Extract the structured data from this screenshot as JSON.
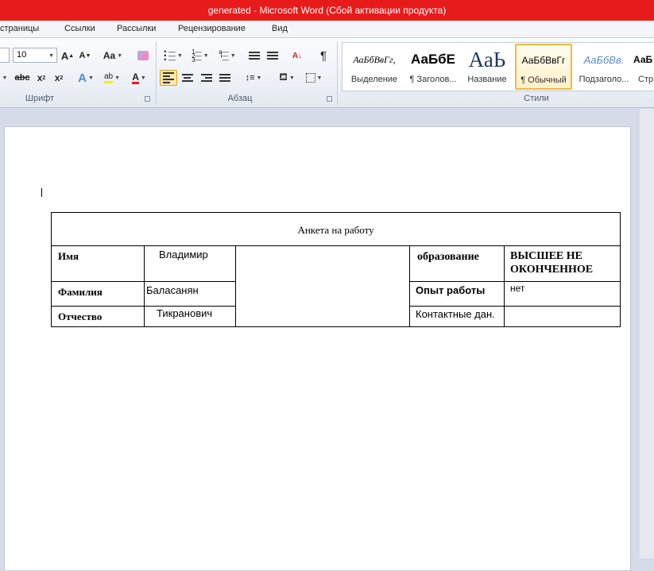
{
  "window": {
    "title_doc": "generated",
    "title_app": "Microsoft Word (Сбой активации продукта)"
  },
  "tabs": [
    "страницы",
    "Ссылки",
    "Рассылки",
    "Рецензирование",
    "Вид"
  ],
  "ribbon": {
    "font_size": "10",
    "groups": {
      "font": "Шрифт",
      "paragraph": "Абзац",
      "styles": "Стили"
    },
    "font_buttons": {
      "grow": "A",
      "shrink": "A",
      "case": "Aa",
      "strike": "abc",
      "sub": "x",
      "sup": "x",
      "effects": "A",
      "highlight": "ab",
      "color": "A"
    },
    "pilcrow": "¶",
    "styles": [
      {
        "sample": "АаБбВвГг,",
        "name": "Выделение"
      },
      {
        "sample": "АаБбЕ",
        "name": "¶ Заголов..."
      },
      {
        "sample": "АаЬ",
        "name": "Название"
      },
      {
        "sample": "АаБбВвГг",
        "name": "¶ Обычный"
      },
      {
        "sample": "АаБбВв.",
        "name": "Подзаголо..."
      },
      {
        "sample": "АаБ",
        "name": "Стр"
      }
    ]
  },
  "document": {
    "table": {
      "title": "Анкета на работу",
      "rows": [
        {
          "label": "Имя",
          "value": "Владимир",
          "label2": "образование",
          "value2": "ВЫСШЕЕ НЕ ОКОНЧЕННОЕ"
        },
        {
          "label": "Фамилия",
          "value": "Баласанян",
          "label2": "Опыт работы",
          "value2": "нет"
        },
        {
          "label": "Отчество",
          "value": "Тикранович",
          "label2": "Контактные дан.",
          "value2": ""
        }
      ]
    }
  },
  "colors": {
    "titlebar": "#e81b1b",
    "ribbon_bg": "#e4e9f2",
    "doc_bg": "#d6dbe9",
    "style_active": "#f2b83a"
  }
}
